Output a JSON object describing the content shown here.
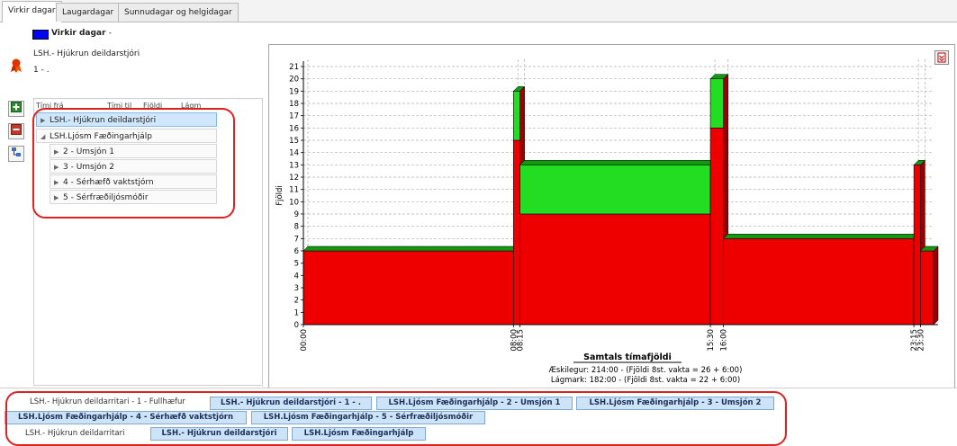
{
  "tabs": [
    {
      "label": "Virkir dagar",
      "active": true
    },
    {
      "label": "Laugardagar",
      "active": false
    },
    {
      "label": "Sunnudagar og helgidagar",
      "active": false
    }
  ],
  "legend": {
    "label": "Virkir dagar",
    "suffix": "-",
    "color": "#0000ff"
  },
  "unit": {
    "title": "LSH.- Hjúkrun deildarstjóri",
    "subtitle": "1 - ."
  },
  "tree": {
    "columns": [
      "Tími frá",
      "Tími til",
      "Fjöldi",
      "Lágm"
    ],
    "rows": [
      {
        "label": "LSH.- Hjúkrun deildarstjóri",
        "level": 0,
        "expanded": false,
        "selected": true
      },
      {
        "label": "LSH.Ljósm Fæðingarhjálp",
        "level": 0,
        "expanded": true,
        "selected": false
      },
      {
        "label": "2 - Umsjón 1",
        "level": 1,
        "expanded": false,
        "selected": false
      },
      {
        "label": "3 - Umsjón 2",
        "level": 1,
        "expanded": false,
        "selected": false
      },
      {
        "label": "4 - Sérhæfð vaktstjórn",
        "level": 1,
        "expanded": false,
        "selected": false
      },
      {
        "label": "5 - Sérfræðiljósmóðir",
        "level": 1,
        "expanded": false,
        "selected": false
      }
    ]
  },
  "chart_data": {
    "type": "area",
    "ylabel": "Fjöldi",
    "ylim": [
      0,
      21
    ],
    "yticks": [
      0,
      1,
      2,
      3,
      4,
      5,
      6,
      7,
      8,
      9,
      10,
      11,
      12,
      13,
      14,
      15,
      16,
      17,
      18,
      19,
      20,
      21
    ],
    "xticks": [
      "00:00",
      "08:00",
      "08:15",
      "15:30",
      "16:00",
      "23:15",
      "23:30"
    ],
    "colors": {
      "min": "#ee0000",
      "extra": "#22dd22"
    },
    "series": [
      {
        "start": "00:00",
        "end": "08:00",
        "min": 6,
        "desired": 6
      },
      {
        "start": "08:00",
        "end": "08:15",
        "min": 15,
        "desired": 19
      },
      {
        "start": "08:15",
        "end": "15:30",
        "min": 9,
        "desired": 13
      },
      {
        "start": "15:30",
        "end": "16:00",
        "min": 16,
        "desired": 20
      },
      {
        "start": "16:00",
        "end": "23:15",
        "min": 7,
        "desired": 7
      },
      {
        "start": "23:15",
        "end": "23:30",
        "min": 13,
        "desired": 13
      },
      {
        "start": "23:30",
        "end": "24:00",
        "min": 6,
        "desired": 6
      }
    ],
    "summary_title": "Samtals tímafjöldi",
    "summary_lines": [
      "Æskilegur: 214:00 - (Fjöldi 8st. vakta = 26 + 6:00)",
      "Lágmark: 182:00 - (Fjöldi 8st. vakta = 22 + 6:00)"
    ]
  },
  "bottom": {
    "row1_label": "LSH.- Hjúkrun deildarritari - 1 - Fullhæfur",
    "row1_pills": [
      "LSH.- Hjúkrun deildarstjóri - 1 - .",
      "LSH.Ljósm Fæðingarhjálp - 2 - Umsjón 1",
      "LSH.Ljósm Fæðingarhjálp - 3 - Umsjón 2"
    ],
    "row2_pills": [
      "LSH.Ljósm Fæðingarhjálp - 4 - Sérhæfð vaktstjórn",
      "LSH.Ljósm Fæðingarhjálp - 5 - Sérfræðiljósmóðir"
    ],
    "row3_label": "LSH.- Hjúkrun deildarritari",
    "row3_pills": [
      "LSH.- Hjúkrun deildarstjóri",
      "LSH.Ljósm Fæðingarhjálp"
    ]
  }
}
